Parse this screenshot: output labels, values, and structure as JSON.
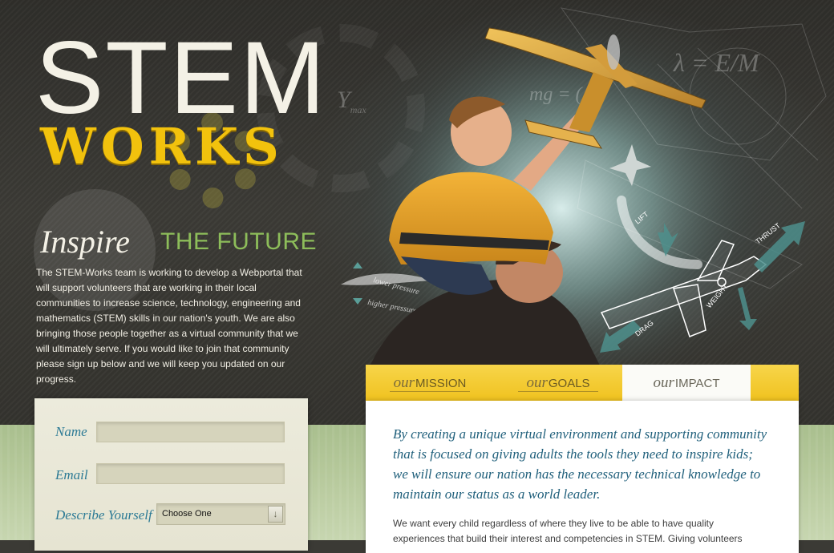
{
  "brand": {
    "title_line1": "STEM",
    "title_line2": "WORKS"
  },
  "intro": {
    "inspire": "Inspire",
    "the_future": "THE FUTURE",
    "body": "The STEM-Works team is working to develop a Webportal that will support volunteers that are working in their local communities to increase science, technology, engineering and mathematics (STEM) skills in our nation's youth. We are also bringing those people together as a virtual community that we will ultimately serve. If you would like to join that community please sign up below and we will keep you updated on our progress."
  },
  "hero": {
    "diagram_labels": [
      "lower pressure",
      "higher pressure",
      "LIFT",
      "THRUST",
      "DRAG",
      "WEIGHT"
    ],
    "formula_1": "Y",
    "formula_1_sub": "max",
    "formula_2": "mg = (",
    "formula_3": "λ = E/M"
  },
  "signup": {
    "name_label": "Name",
    "name_value": "",
    "email_label": "Email",
    "email_value": "",
    "describe_label": "Describe Yourself",
    "describe_selected": "Choose One"
  },
  "tabs": [
    {
      "prefix": "our",
      "label": "MISSION",
      "active": false
    },
    {
      "prefix": "our",
      "label": "GOALS",
      "active": false
    },
    {
      "prefix": "our",
      "label": "IMPACT",
      "active": true
    }
  ],
  "panel": {
    "lead": "By creating a unique virtual environment and supporting community that is focused on giving adults the tools they need to inspire kids; we will ensure our nation has the necessary technical knowledge to maintain our status as a world leader.",
    "body": "We want every child regardless of where they live to be able to have quality experiences that build their interest and competencies in STEM. Giving volunteers"
  },
  "colors": {
    "accent_yellow": "#f2c20d",
    "accent_green": "#8dbd5a",
    "accent_teal": "#2c7a95",
    "dark_bg": "#3b3a35"
  },
  "icons": {
    "select_arrow": "chevron-down-icon"
  }
}
